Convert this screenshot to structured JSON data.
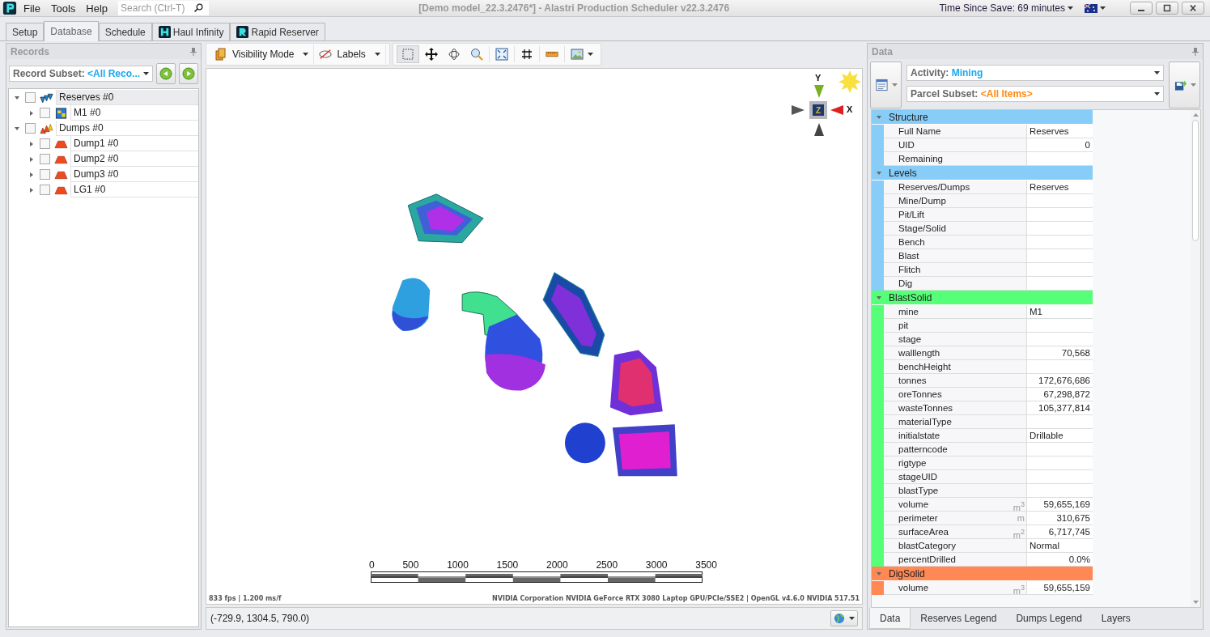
{
  "window": {
    "title": "[Demo model_22.3.2476*] - Alastri Production Scheduler v22.3.2476",
    "time_since_save": "Time Since Save: 69 minutes"
  },
  "menu": [
    "File",
    "Tools",
    "Help"
  ],
  "search": {
    "placeholder": "Search (Ctrl-T)"
  },
  "tabs": [
    {
      "label": "Setup",
      "selected": false,
      "kind": "plain"
    },
    {
      "label": "Database",
      "selected": true,
      "kind": "plain"
    },
    {
      "label": "Schedule",
      "selected": false,
      "kind": "plain"
    },
    {
      "label": "Haul Infinity",
      "selected": false,
      "kind": "haul"
    },
    {
      "label": "Rapid Reserver",
      "selected": false,
      "kind": "rapid"
    }
  ],
  "records": {
    "title": "Records",
    "subset_label": "Record Subset:",
    "subset_value": "<All Reco...",
    "tree": [
      {
        "label": "Reserves #0",
        "kind": "reserves",
        "checked": false,
        "expanded": true,
        "selected": true,
        "children": [
          {
            "label": "M1 #0",
            "kind": "mine",
            "checked": false,
            "expanded": false,
            "selected": false
          }
        ]
      },
      {
        "label": "Dumps #0",
        "kind": "dumps",
        "checked": false,
        "expanded": true,
        "selected": false,
        "children": [
          {
            "label": "Dump1 #0",
            "kind": "dump",
            "checked": false,
            "expanded": false,
            "selected": false
          },
          {
            "label": "Dump2 #0",
            "kind": "dump",
            "checked": false,
            "expanded": false,
            "selected": false
          },
          {
            "label": "Dump3 #0",
            "kind": "dump",
            "checked": false,
            "expanded": false,
            "selected": false
          },
          {
            "label": "LG1 #0",
            "kind": "dump",
            "checked": false,
            "expanded": false,
            "selected": false
          }
        ]
      }
    ]
  },
  "toolbar": {
    "visibility": "Visibility Mode",
    "labels": "Labels"
  },
  "viewport": {
    "axis_y": "Y",
    "axis_x": "X",
    "axis_z": "Z",
    "scale_ticks": [
      "0",
      "500",
      "1000",
      "1500",
      "2000",
      "2500",
      "3000",
      "3500"
    ],
    "fps": "833 fps | 1.200 ms/f",
    "renderer": "NVIDIA Corporation NVIDIA GeForce RTX 3080 Laptop GPU/PCIe/SSE2 | OpenGL v4.6.0 NVIDIA 517.51"
  },
  "status": {
    "coordinates": "(-729.9, 1304.5, 790.0)"
  },
  "data": {
    "title": "Data",
    "activity_label": "Activity:",
    "activity_value": "Mining",
    "parcel_label": "Parcel Subset:",
    "parcel_value": "<All Items>",
    "sections": [
      {
        "name": "Structure",
        "color": "#88ccf8",
        "rows": [
          {
            "name": "Full Name",
            "value": "Reserves",
            "kind": "text"
          },
          {
            "name": "UID",
            "value": "0",
            "kind": "number"
          },
          {
            "name": "Remaining"
          }
        ]
      },
      {
        "name": "Levels",
        "color": "#88ccf8",
        "rows": [
          {
            "name": "Reserves/Dumps",
            "value": "Reserves",
            "kind": "text"
          },
          {
            "name": "Mine/Dump"
          },
          {
            "name": "Pit/Lift"
          },
          {
            "name": "Stage/Solid"
          },
          {
            "name": "Bench"
          },
          {
            "name": "Blast"
          },
          {
            "name": "Flitch"
          },
          {
            "name": "Dig"
          }
        ]
      },
      {
        "name": "BlastSolid",
        "color": "#55ff77",
        "rows": [
          {
            "name": "mine",
            "value": "M1",
            "kind": "text"
          },
          {
            "name": "pit"
          },
          {
            "name": "stage"
          },
          {
            "name": "walllength",
            "value": "70,568",
            "kind": "number"
          },
          {
            "name": "benchHeight"
          },
          {
            "name": "tonnes",
            "value": "172,676,686",
            "kind": "number"
          },
          {
            "name": "oreTonnes",
            "value": "67,298,872",
            "kind": "number"
          },
          {
            "name": "wasteTonnes",
            "value": "105,377,814",
            "kind": "number"
          },
          {
            "name": "materialType"
          },
          {
            "name": "initialstate",
            "value": "Drillable",
            "kind": "text"
          },
          {
            "name": "patterncode"
          },
          {
            "name": "rigtype"
          },
          {
            "name": "stageUID"
          },
          {
            "name": "blastType"
          },
          {
            "name": "volume",
            "unit": "m$^{3}$",
            "value": "59,655,169",
            "kind": "number"
          },
          {
            "name": "perimeter",
            "unit": "m",
            "value": "310,675",
            "kind": "number"
          },
          {
            "name": "surfaceArea",
            "unit": "m$^{2}$",
            "value": "6,717,745",
            "kind": "number"
          },
          {
            "name": "blastCategory",
            "value": "Normal",
            "kind": "text"
          },
          {
            "name": "percentDrilled",
            "value": "0.0%",
            "kind": "number"
          }
        ]
      },
      {
        "name": "DigSolid",
        "color": "#ff8855",
        "rows": [
          {
            "name": "volume",
            "unit": "m$^{3}$",
            "value": "59,655,159",
            "kind": "number"
          }
        ]
      }
    ],
    "bottom_tabs": [
      {
        "label": "Data",
        "selected": true
      },
      {
        "label": "Reserves Legend",
        "selected": false
      },
      {
        "label": "Dumps Legend",
        "selected": false
      },
      {
        "label": "Layers",
        "selected": false
      }
    ]
  }
}
